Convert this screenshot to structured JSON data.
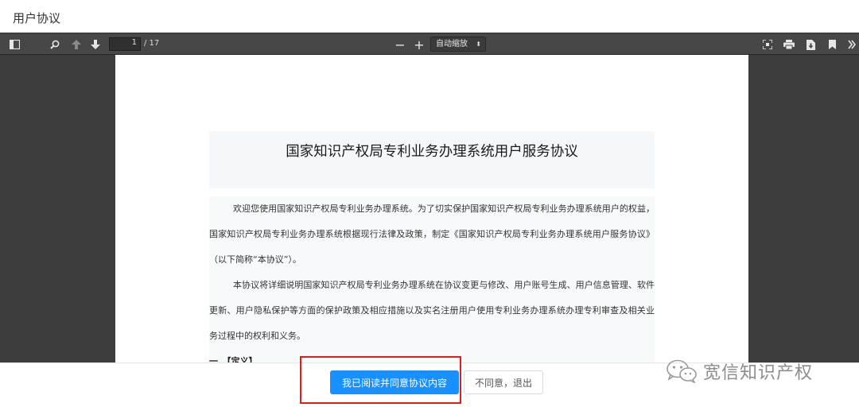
{
  "dialog": {
    "title": "用户协议"
  },
  "viewer": {
    "toolbar": {
      "sidebar_icon": "sidebar-toggle-icon",
      "search_icon": "search-icon",
      "prev_icon": "arrow-up-icon",
      "next_icon": "arrow-down-icon",
      "page_number": "1",
      "page_total": "/ 17",
      "zoom_out_label": "−",
      "zoom_in_label": "+",
      "zoom_value": "自动缩放",
      "presentation_icon": "fullscreen-icon",
      "print_icon": "print-icon",
      "download_icon": "download-icon",
      "bookmark_icon": "bookmark-icon",
      "more_icon": "double-chevron-right-icon"
    },
    "document": {
      "title": "国家知识产权局专利业务办理系统用户服务协议",
      "paragraph1": "欢迎您使用国家知识产权局专利业务办理系统。为了切实保护国家知识产权局专利业务办理系统用户的权益，国家知识产权局专利业务办理系统根据现行法律及政策，制定《国家知识产权局专利业务办理系统用户服务协议》（以下简称“本协议”）。",
      "paragraph2": "本协议将详细说明国家知识产权局专利业务办理系统在协议变更与修改、用户账号生成、用户信息管理、软件更新、用户隐私保护等方面的保护政策及相应措施以及实名注册用户使用专利业务办理系统办理专利审查及相关业务过程中的权利和义务。",
      "section1": "一、【定义】"
    }
  },
  "footer": {
    "agree_label": "我已阅读并同意协议内容",
    "disagree_label": "不同意，退出"
  },
  "watermark": {
    "text": "宽信知识产权",
    "icon": "wechat-icon"
  },
  "colors": {
    "accent": "#1890ff",
    "highlight": "#e21b1b",
    "toolbar": "#474747",
    "viewer_bg": "#3c3c3c"
  }
}
